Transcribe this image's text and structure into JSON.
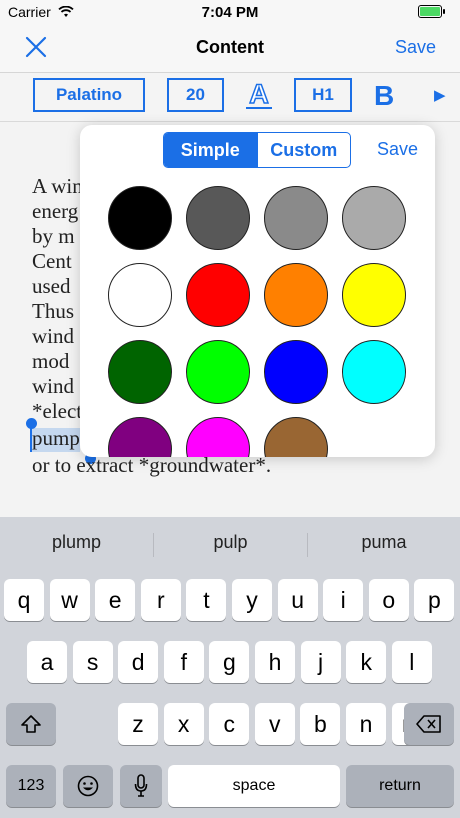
{
  "status": {
    "carrier": "Carrier",
    "time": "7:04 PM"
  },
  "nav": {
    "title": "Content",
    "save": "Save"
  },
  "toolbar": {
    "font": "Palatino",
    "size": "20",
    "heading": "H1",
    "bold": "B",
    "more": "▶",
    "text_color_icon": "A"
  },
  "editor": {
    "lines": [
      "A win",
      "energ",
      "by m",
      "Cent",
      "used",
      "Thus",
      "wind",
      "mod",
      "wind",
      "*elect",
      "pump",
      "or to extract *groundwater*."
    ]
  },
  "popover": {
    "seg_simple": "Simple",
    "seg_custom": "Custom",
    "save": "Save",
    "colors": [
      "#000000",
      "#585858",
      "#8a8a8a",
      "#aaaaaa",
      "#ffffff",
      "#ff0000",
      "#ff8000",
      "#ffff00",
      "#006400",
      "#00ff00",
      "#0000ff",
      "#00ffff",
      "#800080",
      "#ff00ff",
      "#996633"
    ]
  },
  "keyboard": {
    "suggestions": [
      "plump",
      "pulp",
      "puma"
    ],
    "row1": [
      "q",
      "w",
      "e",
      "r",
      "t",
      "y",
      "u",
      "i",
      "o",
      "p"
    ],
    "row2": [
      "a",
      "s",
      "d",
      "f",
      "g",
      "h",
      "j",
      "k",
      "l"
    ],
    "row3": [
      "z",
      "x",
      "c",
      "v",
      "b",
      "n",
      "m"
    ],
    "num": "123",
    "space": "space",
    "return": "return"
  }
}
